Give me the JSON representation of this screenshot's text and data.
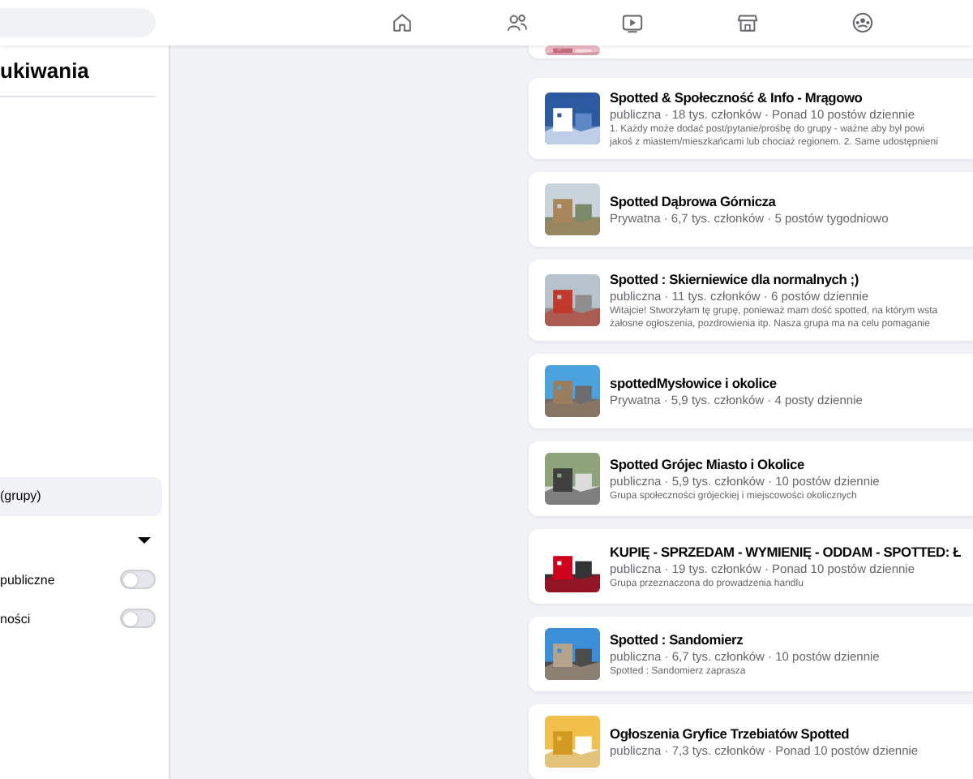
{
  "sidebar": {
    "title": "ukiwania",
    "items": [
      {
        "kind": "item",
        "label": "(grupy)",
        "selected": true
      },
      {
        "kind": "dropdown"
      },
      {
        "kind": "toggle",
        "label": "publiczne",
        "on": false
      },
      {
        "kind": "toggle",
        "label": "ności",
        "on": false
      }
    ]
  },
  "results": [
    {
      "kind": "partial"
    },
    {
      "name": "Spotted & Społeczność & Info - Mrągowo",
      "meta": "publiczna · 18 tys. członków · Ponad 10 postów dziennie",
      "description": [
        "1. Każdy może dodać post/pytanie/prośbę do grupy - ważne aby był powi",
        "jakoś z miastem/mieszkańcami lub chociaż regionem. 2. Same udostępnieni"
      ]
    },
    {
      "name": "Spotted Dąbrowa Górnicza",
      "meta": "Prywatna · 6,7 tys. członków · 5 postów tygodniowo"
    },
    {
      "name": "Spotted : Skierniewice dla normalnych ;)",
      "meta": "publiczna · 11 tys. członków · 6 postów dziennie",
      "description": [
        "Witajcie! Stworzyłam tę grupę, ponieważ mam dość spotted, na którym wsta",
        "żałosne ogłoszenia, pozdrowienia itp. Nasza grupa ma na celu pomaganie"
      ]
    },
    {
      "name": "spottedMysłowice i okolice",
      "meta": "Prywatna · 5,9 tys. członków · 4 posty dziennie"
    },
    {
      "name": "Spotted Grójec Miasto i Okolice",
      "meta": "publiczna · 5,9 tys. członków · 10 postów dziennie",
      "description": [
        "Grupa społeczności grójeckiej i miejscowości okolicznych"
      ]
    },
    {
      "name": "KUPIĘ - SPRZEDAM - WYMIENIĘ - ODDAM - SPOTTED: Ł",
      "meta": "publiczna · 19 tys. członków · Ponad 10 postów dziennie",
      "description": [
        "Grupa przeznaczona do prowadzenia handlu"
      ]
    },
    {
      "name": "Spotted : Sandomierz",
      "meta": "publiczna · 6,7 tys. członków · 10 postów dziennie",
      "description": [
        "Spotted : Sandomierz zaprasza"
      ]
    },
    {
      "name": "Ogłoszenia Gryfice Trzebiatów Spotted",
      "meta": "publiczna · 7,3 tys. członków · Ponad 10 postów dziennie"
    }
  ]
}
